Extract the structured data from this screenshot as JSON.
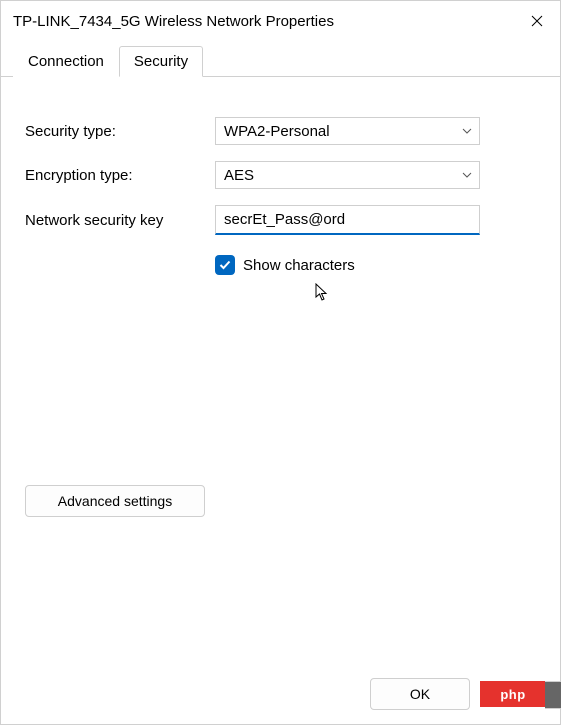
{
  "window": {
    "title": "TP-LINK_7434_5G Wireless Network Properties"
  },
  "tabs": {
    "connection": "Connection",
    "security": "Security",
    "active": "Security"
  },
  "form": {
    "security_type": {
      "label": "Security type:",
      "value": "WPA2-Personal"
    },
    "encryption_type": {
      "label": "Encryption type:",
      "value": "AES"
    },
    "network_key": {
      "label": "Network security key",
      "value": "secrEt_Pass@ord"
    },
    "show_characters": {
      "label": "Show characters",
      "checked": true
    }
  },
  "buttons": {
    "advanced": "Advanced settings",
    "ok": "OK"
  },
  "badge": {
    "text": "php"
  }
}
